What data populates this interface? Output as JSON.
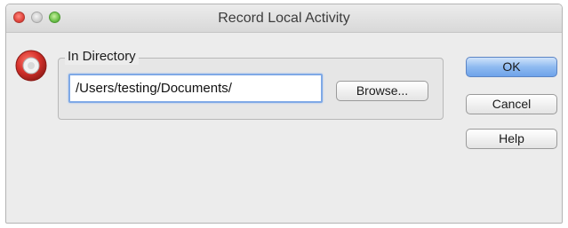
{
  "window": {
    "title": "Record Local Activity"
  },
  "icons": {
    "record": "record-icon",
    "close": "close-icon",
    "minimize": "minimize-icon",
    "zoom": "zoom-icon"
  },
  "directory_group": {
    "label": "In Directory",
    "path_value": "/Users/testing/Documents/",
    "browse_label": "Browse..."
  },
  "buttons": {
    "ok_label": "OK",
    "cancel_label": "Cancel",
    "help_label": "Help"
  },
  "colors": {
    "record_red": "#d4302a",
    "default_button_blue": "#8fbaf0",
    "focus_ring": "#7fa9e6"
  }
}
